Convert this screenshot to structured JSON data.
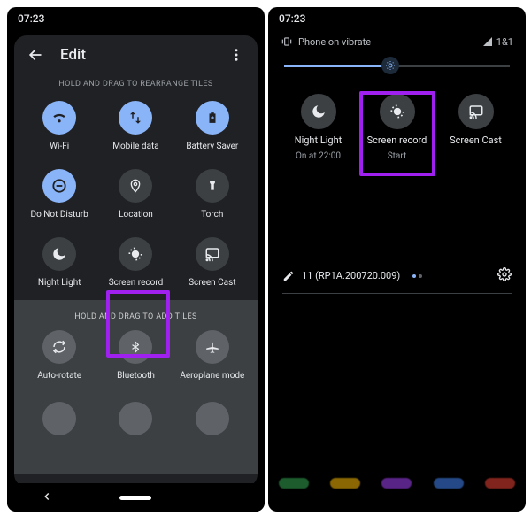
{
  "status_time": "07:23",
  "left": {
    "title": "Edit",
    "hint_top": "HOLD AND DRAG TO REARRANGE TILES",
    "hint_bottom": "HOLD AND DRAG TO ADD TILES",
    "tiles_active": [
      {
        "name": "wifi",
        "label": "Wi-Fi",
        "active": true
      },
      {
        "name": "mobile-data",
        "label": "Mobile data",
        "active": true
      },
      {
        "name": "battery-saver",
        "label": "Battery Saver",
        "active": true
      },
      {
        "name": "dnd",
        "label": "Do Not Disturb",
        "active": true
      },
      {
        "name": "location",
        "label": "Location",
        "active": false
      },
      {
        "name": "torch",
        "label": "Torch",
        "active": false
      },
      {
        "name": "night-light",
        "label": "Night Light",
        "active": false
      },
      {
        "name": "screen-record",
        "label": "Screen record",
        "active": false
      },
      {
        "name": "screen-cast",
        "label": "Screen Cast",
        "active": false
      }
    ],
    "tiles_available": [
      {
        "name": "auto-rotate",
        "label": "Auto-rotate"
      },
      {
        "name": "bluetooth",
        "label": "Bluetooth"
      },
      {
        "name": "aeroplane",
        "label": "Aeroplane mode"
      }
    ]
  },
  "right": {
    "phone_mode": "Phone on vibrate",
    "network": "1&1",
    "brightness_pct": 47,
    "tiles": [
      {
        "name": "night-light",
        "label": "Night Light",
        "sub": "On at 22:00"
      },
      {
        "name": "screen-record",
        "label": "Screen record",
        "sub": "Start"
      },
      {
        "name": "screen-cast",
        "label": "Screen Cast",
        "sub": ""
      }
    ],
    "build": "11 (RP1A.200720.009)",
    "page_index": 0,
    "page_count": 2
  },
  "highlight_color": "#a020f0"
}
